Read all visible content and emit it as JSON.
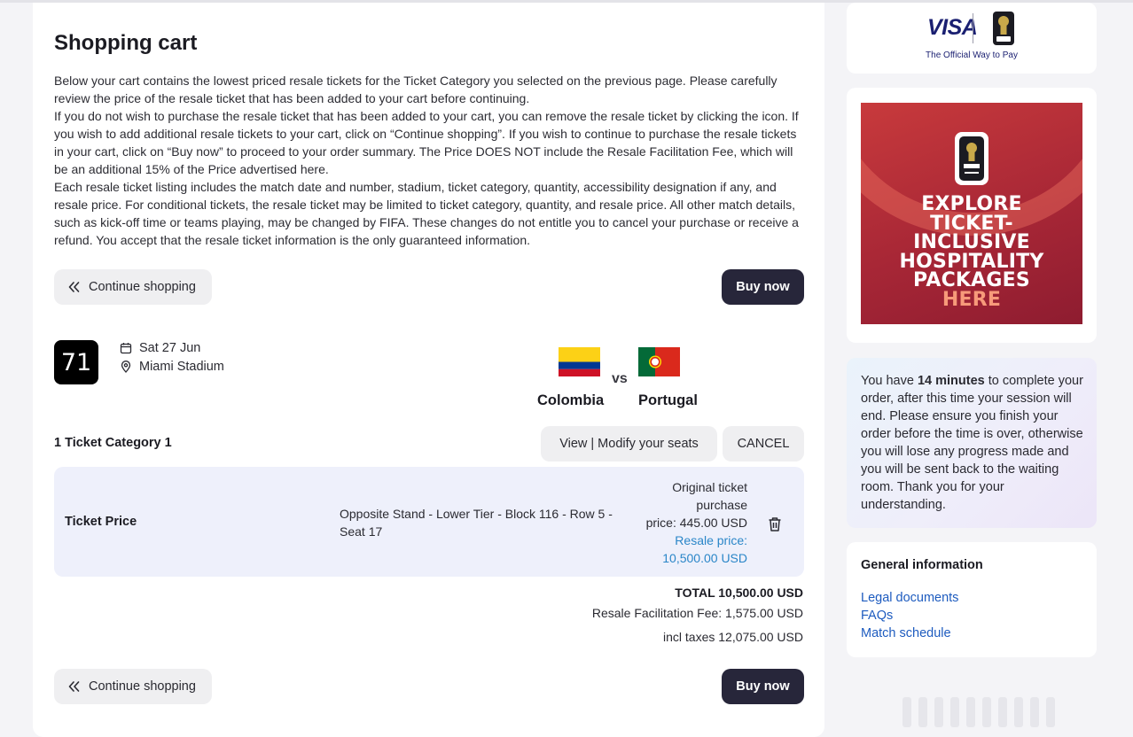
{
  "cart": {
    "title": "Shopping cart",
    "intro": [
      "Below your cart contains the lowest priced resale tickets for the Ticket Category you selected on the previous page. Please carefully review the price of the resale ticket that has been added to your cart before continuing.",
      "If you do not wish to purchase the resale ticket that has been added to your cart, you can remove the resale ticket by clicking the icon. If you wish to add additional resale tickets to your cart, click on “Continue shopping”. If you wish to continue to purchase the resale tickets in your cart, click on “Buy now” to proceed to your order summary. The Price DOES NOT include the Resale Facilitation Fee, which will be an additional 15% of the Price advertised here.",
      "Each resale ticket listing includes the match date and number, stadium, ticket category, quantity, accessibility designation if any, and resale price. For conditional tickets, the resale ticket may be limited to ticket category, quantity, and resale price. All other match details, such as kick-off time or teams playing, may be changed by FIFA. These changes do not entitle you to cancel your purchase or receive a refund. You accept that the resale ticket information is the only guaranteed information."
    ],
    "continue_label": "Continue shopping",
    "buy_label": "Buy now"
  },
  "match": {
    "number": "71",
    "date": "Sat 27 Jun",
    "stadium": "Miami Stadium",
    "home_team": "Colombia",
    "away_team": "Portugal",
    "vs": "vs",
    "home_flag": "colombia-flag",
    "away_flag": "portugal-flag"
  },
  "category": {
    "title": "1 Ticket Category 1",
    "view_modify_label": "View | Modify your seats",
    "cancel_label": "CANCEL"
  },
  "ticket": {
    "label": "Ticket Price",
    "seat": "Opposite Stand - Lower Tier - Block 116 - Row 5 - Seat 17",
    "original_price_lines": [
      "Original ticket",
      "purchase",
      "price: 445.00 USD"
    ],
    "resale_price_lines": [
      "Resale price:",
      "10,500.00 USD"
    ],
    "delete_icon": "trash-icon"
  },
  "totals": {
    "total": "TOTAL 10,500.00 USD",
    "fee": "Resale Facilitation Fee: 1,575.00 USD",
    "incl_taxes": "incl taxes 12,075.00 USD"
  },
  "sponsor": {
    "wordmark": "VISA",
    "tagline": "The Official Way to Pay",
    "colors": {
      "visa_blue": "#1a1f71"
    }
  },
  "promo": {
    "lines": [
      "EXPLORE",
      "TICKET-",
      "INCLUSIVE",
      "HOSPITALITY",
      "PACKAGES"
    ],
    "highlight": "HERE",
    "colors": {
      "background": "#a82736",
      "highlight": "#f79a7a"
    }
  },
  "timer": {
    "prefix": "You have ",
    "minutes": "14 minutes",
    "suffix": " to complete your order, after this time your session will end. Please ensure you finish your order before the time is over, otherwise you will lose any progress made and you will be sent back to the waiting room. Thank you for your understanding."
  },
  "info": {
    "title": "General information",
    "links": [
      "Legal documents",
      "FAQs",
      "Match schedule"
    ]
  },
  "colors": {
    "primary_button": "#27263a",
    "ticket_row_bg": "#eef0fb",
    "link": "#1d5bbf",
    "resale_price": "#2a86c8"
  }
}
